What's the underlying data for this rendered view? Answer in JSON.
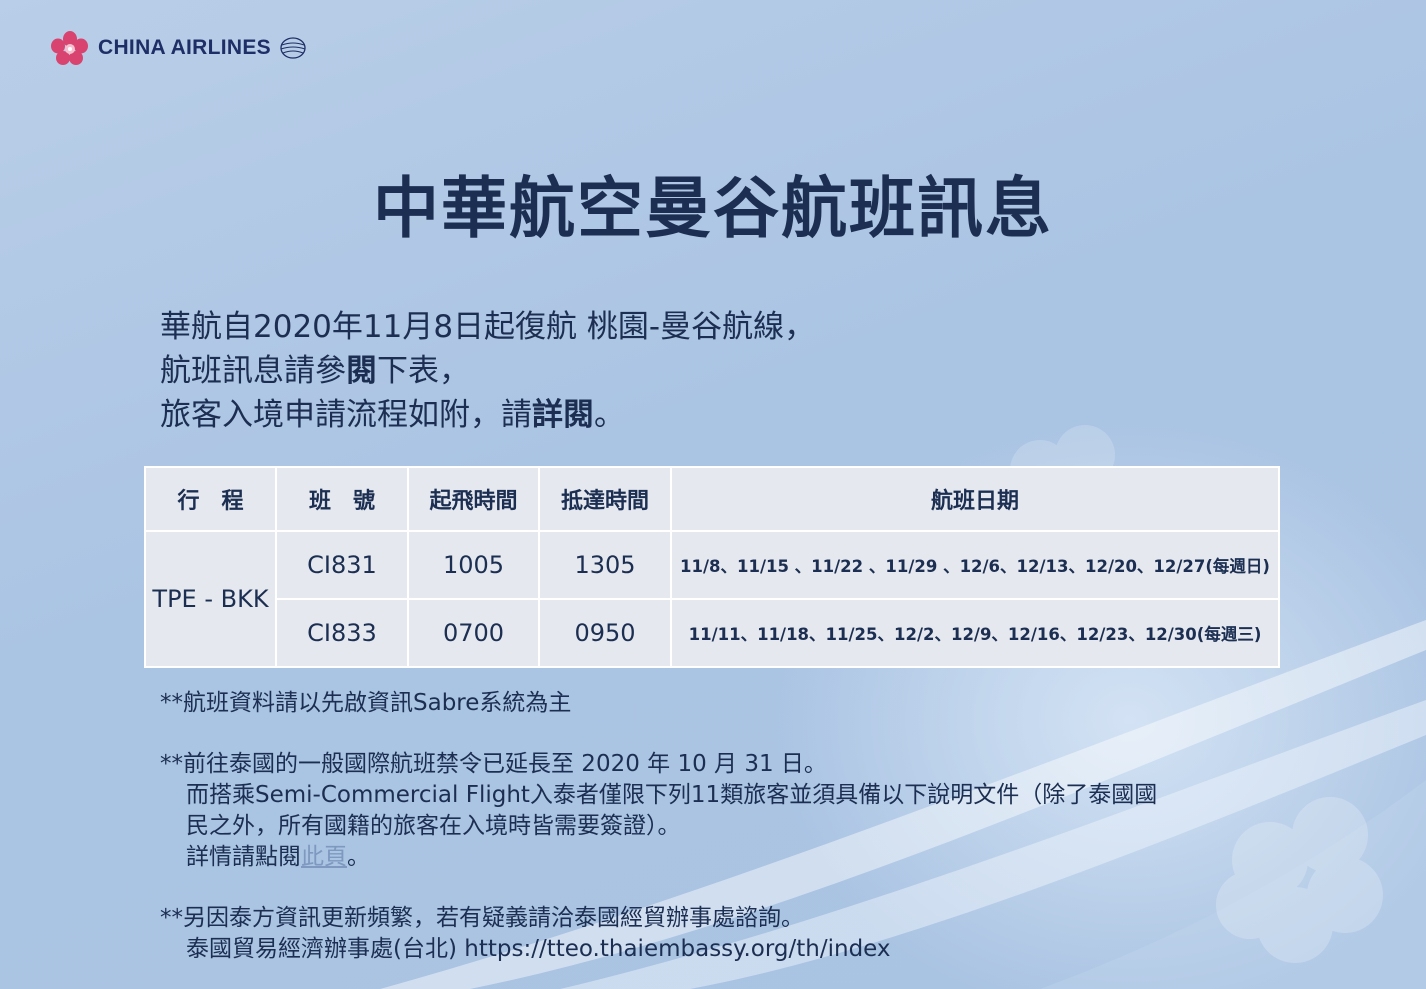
{
  "header": {
    "logo_text": "CHINA AIRLINES",
    "logo_icon": "plum-blossom-icon",
    "title": "中華航空曼谷航班訊息"
  },
  "intro": {
    "line1": "華航自2020年11月8日起復航 桃園-曼谷航線，",
    "line2_a": "航班訊息請參",
    "line2_b": "閱",
    "line2_c": "下表，",
    "line3_a": "旅客入境申請流程如附，請",
    "line3_b": "詳閱",
    "line3_c": "。"
  },
  "table": {
    "headers": [
      "行　程",
      "班　號",
      "起飛時間",
      "抵達時間",
      "航班日期"
    ],
    "route": "TPE - BKK",
    "rows": [
      {
        "flight": "CI831",
        "dep": "1005",
        "arr": "1305",
        "dates": "11/8、11/15 、11/22 、11/29 、12/6、12/13、12/20、12/27(每週日)"
      },
      {
        "flight": "CI833",
        "dep": "0700",
        "arr": "0950",
        "dates": "11/11、11/18、11/25、12/2、12/9、12/16、12/23、12/30(每週三)"
      }
    ]
  },
  "notes": {
    "note1": "**航班資料請以先啟資訊Sabre系統為主",
    "note2_line1": "**前往泰國的一般國際航班禁令已延長至 2020 年 10 月 31 日。",
    "note2_line2": "而搭乘Semi-Commercial Flight入泰者僅限下列11類旅客並須具備以下說明文件（除了泰國國",
    "note2_line3": "民之外，所有國籍的旅客在入境時皆需要簽證）。",
    "note2_line4_a": "詳情請點閱",
    "note2_link": "此頁",
    "note2_line4_c": "。",
    "note3_line1": "**另因泰方資訊更新頻繁，若有疑義請洽泰國經貿辦事處諮詢。",
    "note3_line2": "泰國貿易經濟辦事處(台北) https://tteo.thaiembassy.org/th/index"
  },
  "colors": {
    "background": "#aac4e3",
    "text": "#1c2f52",
    "table_bg": "#e5e8ee",
    "logo_pink": "#d9436f",
    "link": "#7e98bf"
  }
}
